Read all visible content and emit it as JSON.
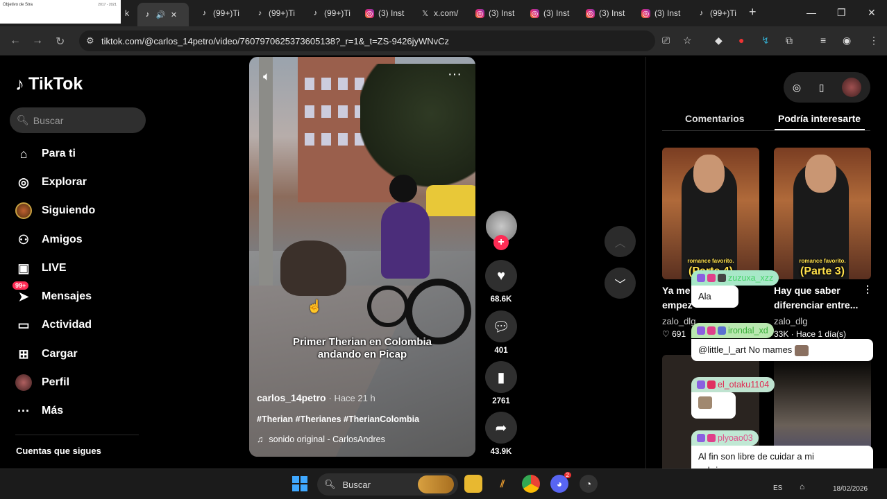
{
  "browser": {
    "thumb_tab": {
      "title": "Objetivo de Stra",
      "right": "2017 - 2021"
    },
    "tabs": [
      {
        "label": "(99+)Ti",
        "icon": "tiktok-icon"
      },
      {
        "label": "(99+)Ti",
        "icon": "tiktok-icon"
      },
      {
        "label": "(99+)Ti",
        "icon": "tiktok-icon"
      },
      {
        "label": "(3) Inst",
        "icon": "instagram-icon"
      },
      {
        "label": "x.com/",
        "icon": "x-icon"
      },
      {
        "label": "(3) Inst",
        "icon": "instagram-icon"
      },
      {
        "label": "(3) Inst",
        "icon": "instagram-icon"
      },
      {
        "label": "(3) Inst",
        "icon": "instagram-icon"
      },
      {
        "label": "(3) Inst",
        "icon": "instagram-icon"
      },
      {
        "label": "(99+)Ti",
        "icon": "tiktok-icon"
      }
    ],
    "url": "tiktok.com/@carlos_14petro/video/7607970625373605138?_r=1&_t=ZS-9426jyWNvCz"
  },
  "tiktok": {
    "logo": "TikTok",
    "search_placeholder": "Buscar",
    "nav": [
      {
        "label": "Para ti",
        "icon": "home-icon"
      },
      {
        "label": "Explorar",
        "icon": "compass-icon"
      },
      {
        "label": "Siguiendo",
        "icon": "following-icon"
      },
      {
        "label": "Amigos",
        "icon": "friends-icon"
      },
      {
        "label": "LIVE",
        "icon": "live-icon"
      },
      {
        "label": "Mensajes",
        "icon": "messages-icon",
        "badge": "99+"
      },
      {
        "label": "Actividad",
        "icon": "activity-icon"
      },
      {
        "label": "Cargar",
        "icon": "upload-icon"
      },
      {
        "label": "Perfil",
        "icon": "profile-icon"
      },
      {
        "label": "Más",
        "icon": "more-icon"
      }
    ],
    "following_label": "Cuentas que sigues"
  },
  "video": {
    "caption_line1": "Primer Therian en Colombia",
    "caption_line2": "andando en Picap",
    "author": "carlos_14petro",
    "time": "· Hace 21 h",
    "hashtags": "#Therian #Therianes #TherianColombia",
    "sound": "sonido original - CarlosAndres"
  },
  "actions": {
    "likes": "68.6K",
    "comments": "401",
    "saves": "2761",
    "shares": "43.9K"
  },
  "right_panel": {
    "tab_comments": "Comentarios",
    "tab_suggested": "Podría interesarte",
    "recs": [
      {
        "thumb_small": "romance favorito.",
        "thumb_label": "(Parte 4)",
        "title_1": "Ya me",
        "title_2": "empez",
        "author": "zalo_dlg",
        "meta": "♡ 691"
      },
      {
        "thumb_small": "romance favorito.",
        "thumb_label": "(Parte 3)",
        "title_1": "Hay que saber",
        "title_2": "diferenciar entre...",
        "author": "zalo_dlg",
        "meta": "33K · Hace 1 día(s)"
      }
    ]
  },
  "chat": [
    {
      "user": "zuzuxa_xzz",
      "color": "#48d46b",
      "bg": "#a8e8c8",
      "message": "Ala"
    },
    {
      "user": "irondal_xd",
      "color": "#3aaf3a",
      "bg": "#b9e8b0",
      "message": "@little_l_art No mames"
    },
    {
      "user": "el_otaku1104",
      "color": "#e02850",
      "bg": "#bfe3d0",
      "message": ""
    },
    {
      "user": "plyoao03",
      "color": "#e0508a",
      "bg": "#c0e8d4",
      "message": "Al fin son libre de cuidar a mi sobrinoooooooo"
    }
  ],
  "taskbar": {
    "search": "Buscar",
    "lang": "ES",
    "date": "18/02/2026",
    "discord_badge": "2"
  }
}
